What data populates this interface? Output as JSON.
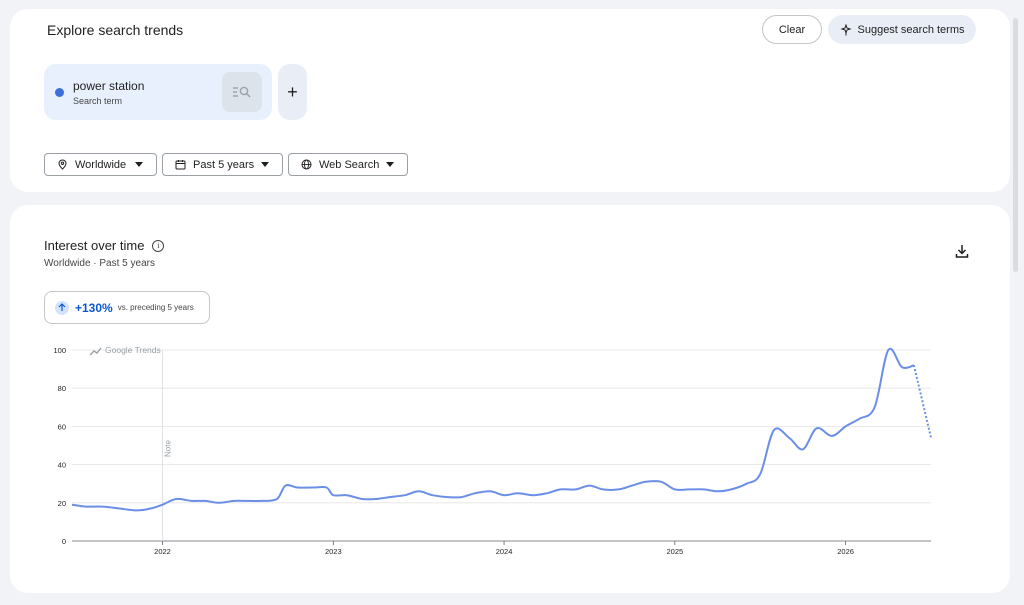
{
  "header": {
    "title": "Explore search trends",
    "clear_label": "Clear",
    "suggest_label": "Suggest search terms"
  },
  "terms": [
    {
      "name": "power station",
      "type": "Search term",
      "color": "#3c6fd8"
    }
  ],
  "add_term_label": "+",
  "filters": {
    "geo": "Worldwide",
    "time": "Past 5 years",
    "property": "Web Search"
  },
  "interest": {
    "title": "Interest over time",
    "info_symbol": "i",
    "subtitle": "Worldwide · Past 5 years",
    "change_value": "+130%",
    "change_desc": "vs. preceding 5 years",
    "watermark": "Google Trends",
    "note_label": "Note"
  },
  "chart_data": {
    "type": "line",
    "ylim": [
      0,
      100
    ],
    "yticks": [
      0,
      20,
      40,
      60,
      80,
      100
    ],
    "xlim": [
      2021.47,
      2026.5
    ],
    "xticks": [
      2022,
      2023,
      2024,
      2025,
      2026
    ],
    "xtick_labels": [
      "2022",
      "2023",
      "2024",
      "2025",
      "2026"
    ],
    "grid": true,
    "color": "#6b8fe6",
    "note_x": 2022.0,
    "partial_from": 2026.4,
    "series": [
      {
        "x": [
          2021.47,
          2021.55,
          2021.65,
          2021.75,
          2021.85,
          2021.93,
          2022.0,
          2022.08,
          2022.17,
          2022.25,
          2022.33,
          2022.42,
          2022.5,
          2022.58,
          2022.67,
          2022.72,
          2022.79,
          2022.88,
          2022.96,
          2023.0,
          2023.08,
          2023.17,
          2023.25,
          2023.33,
          2023.42,
          2023.5,
          2023.58,
          2023.67,
          2023.75,
          2023.83,
          2023.92,
          2024.0,
          2024.08,
          2024.17,
          2024.25,
          2024.33,
          2024.42,
          2024.5,
          2024.58,
          2024.67,
          2024.75,
          2024.83,
          2024.92,
          2025.0,
          2025.08,
          2025.17,
          2025.25,
          2025.33,
          2025.42,
          2025.5,
          2025.58,
          2025.67,
          2025.75,
          2025.83,
          2025.92,
          2026.0,
          2026.08,
          2026.17,
          2026.25,
          2026.33,
          2026.4,
          2026.5
        ],
        "y": [
          19,
          18,
          18,
          17,
          16,
          17,
          19,
          22,
          21,
          21,
          20,
          21,
          21,
          21,
          22,
          29,
          28,
          28,
          28,
          24,
          24,
          22,
          22,
          23,
          24,
          26,
          24,
          23,
          23,
          25,
          26,
          24,
          25,
          24,
          25,
          27,
          27,
          29,
          27,
          27,
          29,
          31,
          31,
          27,
          27,
          27,
          26,
          27,
          30,
          35,
          58,
          54,
          48,
          59,
          55,
          60,
          64,
          70,
          100,
          91,
          92,
          54
        ]
      }
    ]
  }
}
